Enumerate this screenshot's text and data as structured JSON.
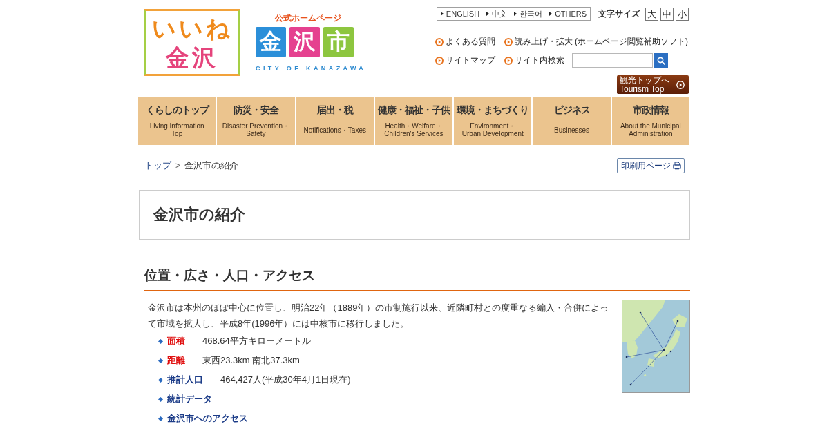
{
  "logo": {
    "slogan_line_1": "いいね",
    "slogan_line_2": "金沢",
    "tagline": "公式ホームページ",
    "tiles": [
      {
        "text": "金",
        "color": "#2b8fd9"
      },
      {
        "text": "沢",
        "color": "#e5418f"
      },
      {
        "text": "市",
        "color": "#8dc63f"
      }
    ],
    "city_name": "CITY OF KANAZAWA"
  },
  "language_links": [
    "ENGLISH",
    "中文",
    "한국어",
    "OTHERS"
  ],
  "font_size": {
    "label": "文字サイズ",
    "options": [
      "大",
      "中",
      "小"
    ]
  },
  "utility_links": [
    {
      "label": "よくある質問"
    },
    {
      "label": "読み上げ・拡大",
      "note": "(ホームページ閲覧補助ソフト)"
    },
    {
      "label": "サイトマップ"
    }
  ],
  "site_search": {
    "label": "サイト内検索"
  },
  "tourism_button": {
    "line_1": "観光トップへ",
    "line_2": "Tourism Top"
  },
  "nav": [
    {
      "label": "くらしのトップ",
      "subtitle": "Living Information\nTop"
    },
    {
      "label": "防災・安全",
      "subtitle": "Disaster Prevention・\nSafety"
    },
    {
      "label": "届出・税",
      "subtitle": "Notifications・Taxes"
    },
    {
      "label": "健康・福祉・子供",
      "subtitle": "Health・Welfare・\nChildren's Services"
    },
    {
      "label": "環境・まちづくり",
      "subtitle": "Environment・\nUrban Development"
    },
    {
      "label": "ビジネス",
      "subtitle": "Businesses"
    },
    {
      "label": "市政情報",
      "subtitle": "About the Municipal\nAdministration"
    }
  ],
  "breadcrumb": {
    "home": "トップ",
    "separator": ">",
    "current": "金沢市の紹介"
  },
  "print_button": "印刷用ページ",
  "page_title": "金沢市の紹介",
  "section": {
    "heading": "位置・広さ・人口・アクセス",
    "paragraph": "金沢市は本州のほぼ中心に位置し、明治22年（1889年）の市制施行以来、近隣町村との度重なる編入・合併によって市域を拡大し、平成8年(1996年）には中核市に移行しました。",
    "facts": [
      {
        "kind": "term",
        "label": "面積",
        "value": "468.64平方キローメートル"
      },
      {
        "kind": "term",
        "label": "距離",
        "value": "東西23.3km 南北37.3km"
      },
      {
        "kind": "link",
        "label": "推計人口",
        "value": "464,427人(平成30年4月1日現在)"
      },
      {
        "kind": "link",
        "label": "統計データ"
      },
      {
        "kind": "link",
        "label": "金沢市へのアクセス"
      }
    ]
  }
}
